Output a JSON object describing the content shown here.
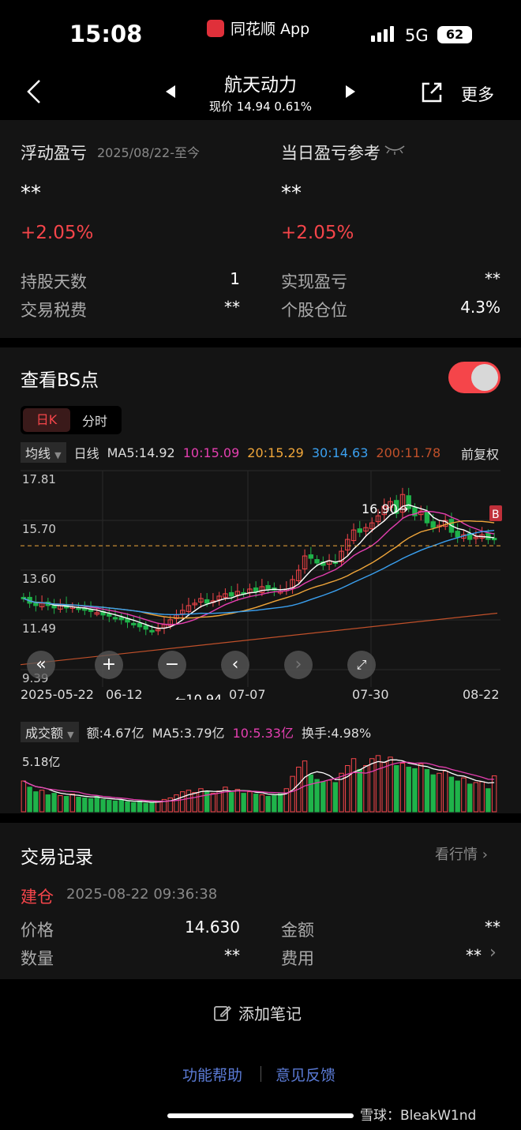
{
  "status_bar": {
    "time": "15:08",
    "app_name": "同花顺 App",
    "network": "5G",
    "battery": "62"
  },
  "nav": {
    "title": "航天动力",
    "subtitle": "现价 14.94 0.61%",
    "more_label": "更多",
    "icons": [
      "back-icon",
      "prev-stock-icon",
      "next-stock-icon",
      "share-icon"
    ]
  },
  "pnl": {
    "floating_label": "浮动盈亏",
    "floating_date": "2025/08/22-至今",
    "floating_value": "**",
    "floating_pct": "+2.05%",
    "daily_label": "当日盈亏参考",
    "daily_value": "**",
    "daily_pct": "+2.05%",
    "rows": [
      {
        "l1": "持股天数",
        "v1": "1",
        "l2": "实现盈亏",
        "v2": "**"
      },
      {
        "l1": "交易税费",
        "v1": "**",
        "l2": "个股仓位",
        "v2": "4.3%"
      }
    ]
  },
  "bs": {
    "title": "查看BS点",
    "toggle_on": true,
    "tabs": [
      "日K",
      "分时"
    ],
    "ma_select": "均线",
    "ma_period": "日线",
    "ma5": "MA5:14.92",
    "ma10": "10:15.09",
    "ma20": "20:15.29",
    "ma30": "30:14.63",
    "ma200": "200:11.78",
    "adjust": "前复权",
    "colors": {
      "ma5": "#ffffff",
      "ma10": "#e43fb0",
      "ma20": "#f0a63a",
      "ma30": "#3aa0f0",
      "ma200": "#c0502a",
      "up": "#f5454a",
      "down": "#1fb34a"
    }
  },
  "chart_data": {
    "type": "candlestick",
    "y_ticks": [
      "17.81",
      "15.70",
      "13.60",
      "11.49",
      "9.39"
    ],
    "x_ticks": [
      "2025-05-22",
      "06-12",
      "07-07",
      "07-30",
      "08-22"
    ],
    "ylim": [
      9.39,
      17.81
    ],
    "high_annotation": "16.90→",
    "low_annotation": "←10.94",
    "cost_line": 14.63,
    "buy_marker": "B",
    "close": [
      12.4,
      12.2,
      12.1,
      12.2,
      12.1,
      12.0,
      12.1,
      12.0,
      12.05,
      11.95,
      11.9,
      11.85,
      11.8,
      11.7,
      11.65,
      11.55,
      11.5,
      11.4,
      11.3,
      11.2,
      11.1,
      11.0,
      11.1,
      11.3,
      11.5,
      11.7,
      11.9,
      12.1,
      12.2,
      12.4,
      12.2,
      12.3,
      12.5,
      12.6,
      12.5,
      12.7,
      12.6,
      12.8,
      12.7,
      12.9,
      12.8,
      12.75,
      12.7,
      12.8,
      13.2,
      13.6,
      14.2,
      14.1,
      13.9,
      13.8,
      14.0,
      13.9,
      14.4,
      14.9,
      15.3,
      15.2,
      15.4,
      15.6,
      15.9,
      16.3,
      16.5,
      16.0,
      16.8,
      16.2,
      15.9,
      16.1,
      15.6,
      15.4,
      15.5,
      15.7,
      15.2,
      15.0,
      15.1,
      14.9,
      15.0,
      15.1,
      14.9,
      14.94
    ],
    "volume_series": {
      "name": "成交额",
      "values": [
        4.0,
        3.2,
        2.6,
        2.8,
        2.2,
        2.4,
        2.1,
        2.0,
        2.3,
        1.9,
        1.8,
        1.7,
        2.0,
        1.6,
        1.5,
        1.4,
        1.5,
        1.3,
        1.2,
        1.4,
        1.1,
        1.2,
        1.4,
        1.6,
        1.8,
        2.2,
        2.6,
        2.8,
        2.5,
        3.0,
        2.6,
        2.4,
        2.7,
        3.2,
        2.5,
        2.9,
        2.4,
        2.6,
        2.3,
        2.2,
        2.0,
        2.1,
        2.4,
        3.0,
        4.6,
        5.8,
        6.6,
        4.8,
        4.2,
        3.9,
        4.1,
        3.8,
        5.0,
        6.0,
        6.9,
        5.5,
        6.0,
        6.9,
        7.3,
        6.4,
        7.1,
        6.0,
        6.3,
        5.8,
        5.6,
        6.2,
        5.5,
        4.8,
        5.0,
        5.3,
        4.5,
        4.0,
        4.4,
        3.6,
        3.8,
        3.9,
        3.0,
        4.67
      ]
    }
  },
  "volume": {
    "select": "成交额",
    "amount": "额:4.67亿",
    "ma5": "MA5:3.79亿",
    "ma10": "10:5.33亿",
    "turnover": "换手:4.98%",
    "y_tick": "5.18亿"
  },
  "records": {
    "title": "交易记录",
    "link": "看行情",
    "type": "建仓",
    "datetime": "2025-08-22 09:36:38",
    "price_label": "价格",
    "price": "14.630",
    "amount_label": "金额",
    "amount": "**",
    "qty_label": "数量",
    "qty": "**",
    "fee_label": "费用",
    "fee": "**"
  },
  "footer": {
    "note_label": "添加笔记",
    "help": "功能帮助",
    "feedback": "意见反馈",
    "watermark": "雪球：BleakW1nd"
  }
}
